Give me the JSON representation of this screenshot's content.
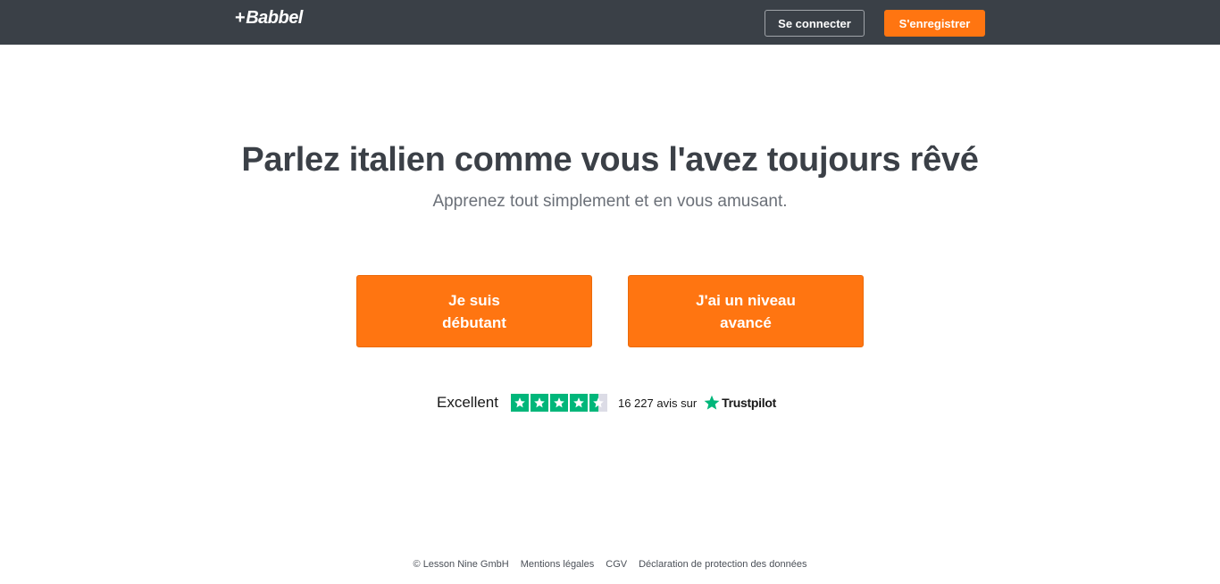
{
  "header": {
    "logo_plus": "+",
    "logo_text": "Babbel",
    "login_label": "Se connecter",
    "register_label": "S'enregistrer"
  },
  "hero": {
    "title": "Parlez italien comme vous l'avez toujours rêvé",
    "subtitle": "Apprenez tout simplement et en vous amusant.",
    "beginner_label": "Je suis débutant",
    "advanced_label": "J'ai un niveau avancé"
  },
  "trustpilot": {
    "rating_text": "Excellent",
    "rating_stars": 4.5,
    "reviews_text": "16 227 avis sur",
    "brand": "Trustpilot"
  },
  "footer": {
    "copyright": "© Lesson Nine GmbH",
    "legal": "Mentions légales",
    "terms": "CGV",
    "privacy": "Déclaration de protection des données"
  },
  "colors": {
    "header_bg": "#3a4047",
    "accent": "#ff7511",
    "trustpilot_green": "#00b67a"
  }
}
